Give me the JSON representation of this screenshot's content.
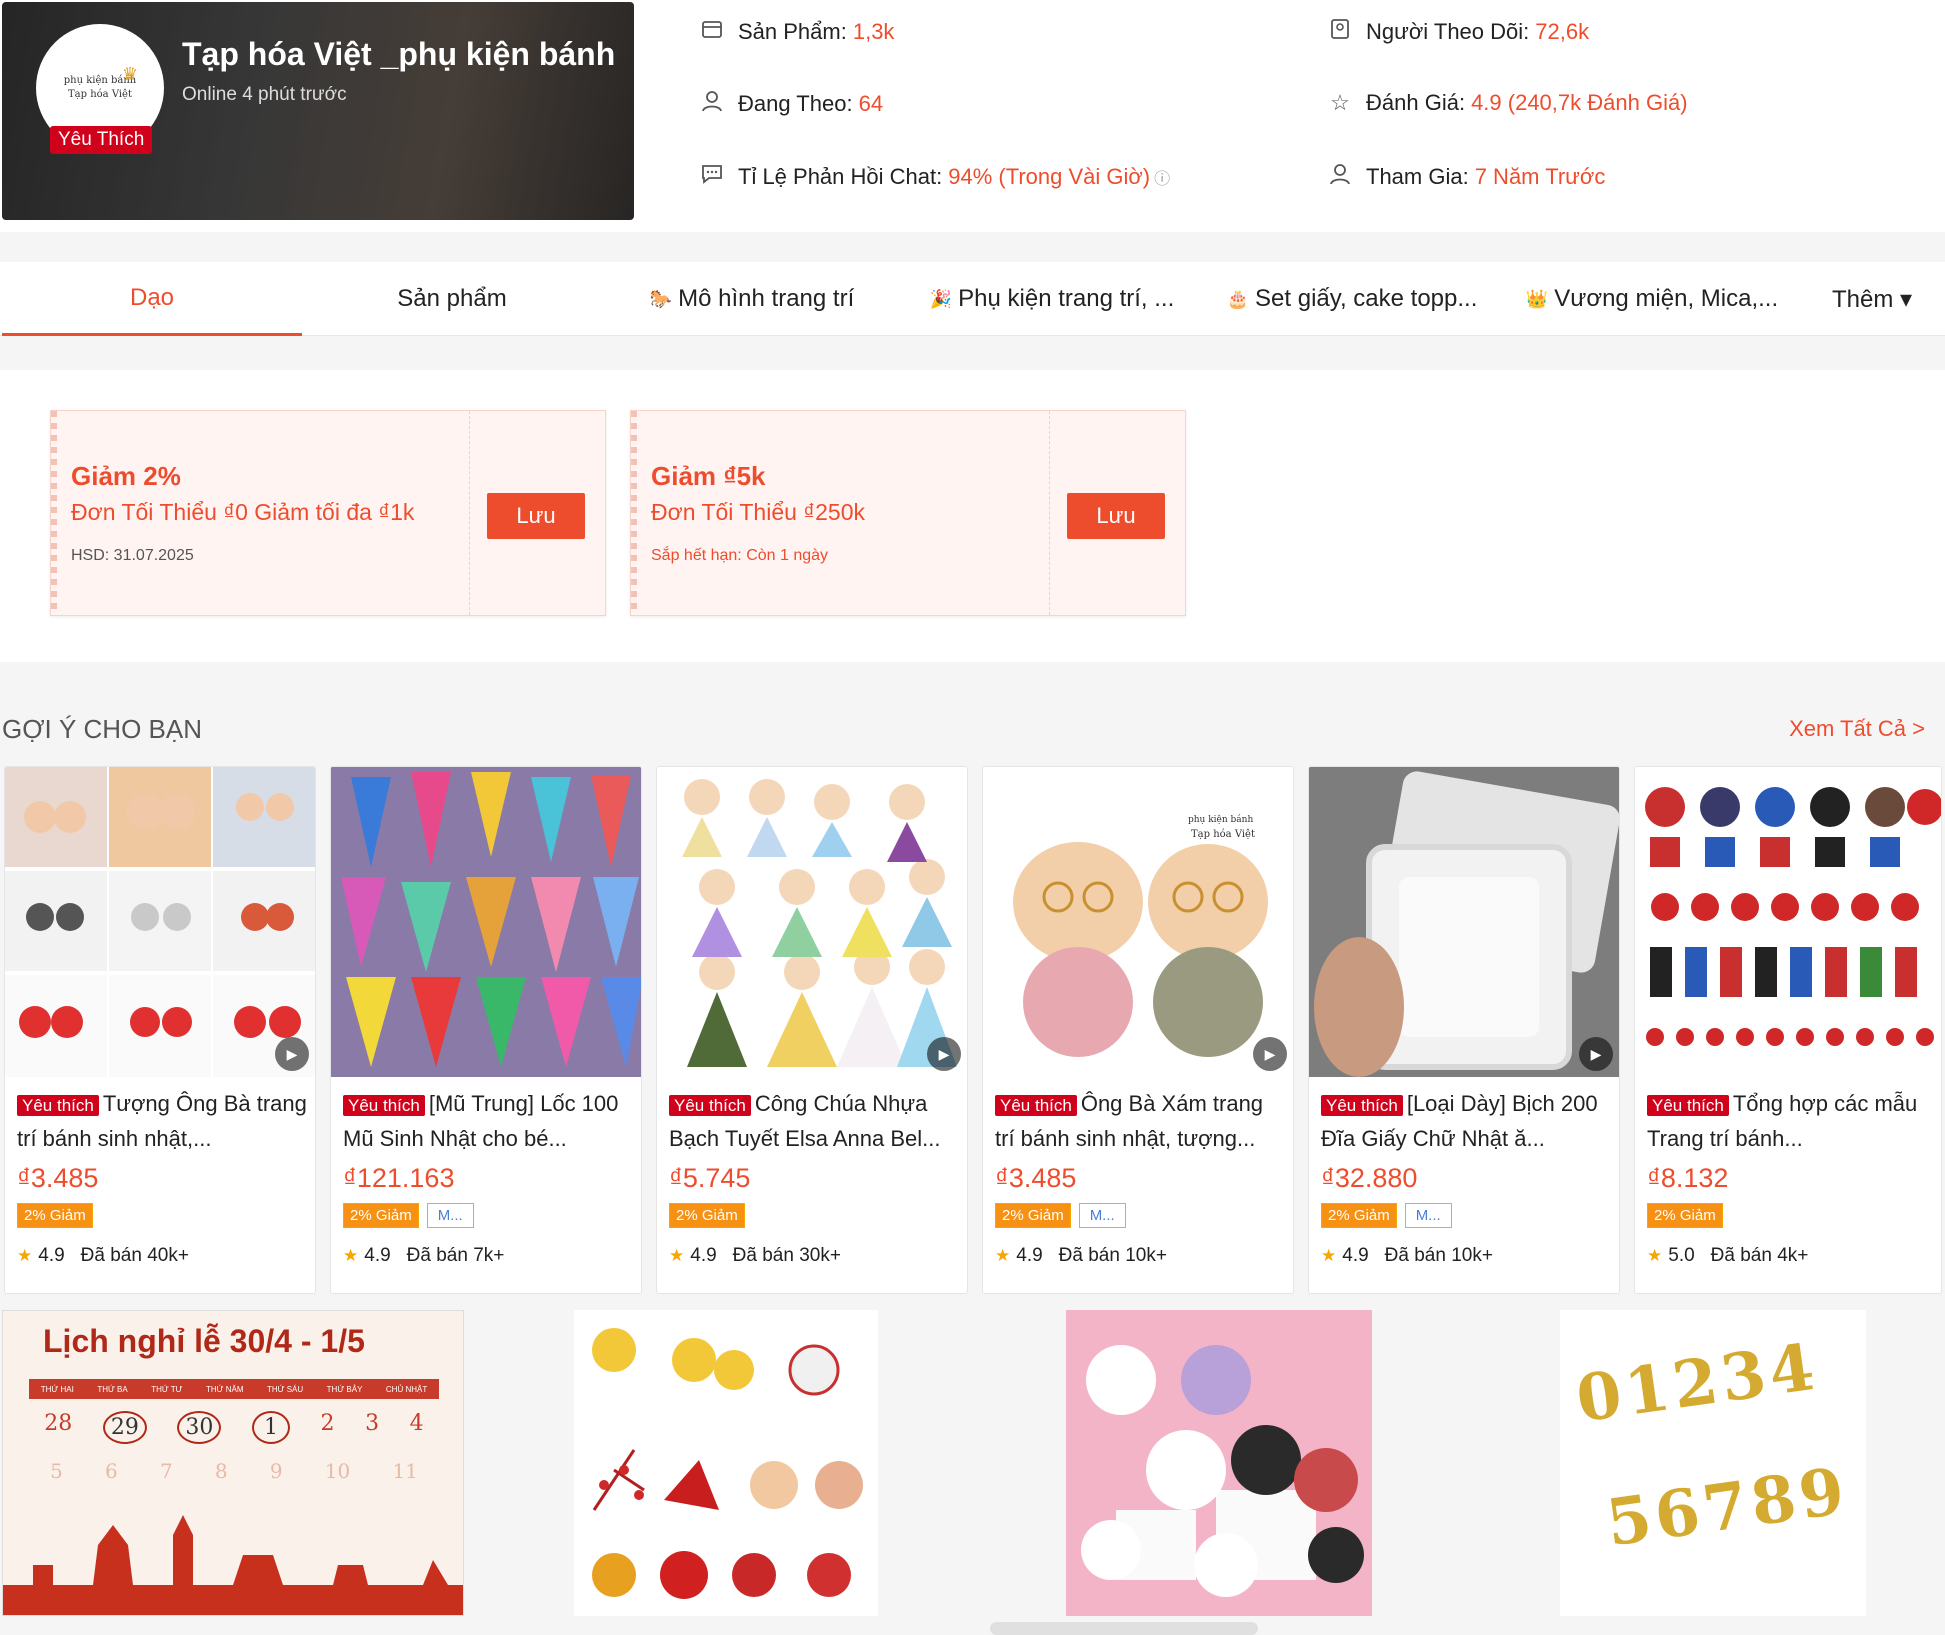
{
  "shop": {
    "name": "Tạp hóa Việt _phụ kiện bánh",
    "online": "Online 4 phút trước",
    "badge": "Yêu Thích",
    "logo_line1": "phụ kiện bánh",
    "logo_line2": "Tạp hóa Việt"
  },
  "stats": {
    "products": {
      "label": "Sản Phẩm:",
      "value": "1,3k",
      "icon": "storefront-icon"
    },
    "following": {
      "label": "Đang Theo:",
      "value": "64",
      "icon": "person-icon"
    },
    "chat": {
      "label": "Tỉ Lệ Phản Hồi Chat:",
      "value": "94% (Trong Vài Giờ)",
      "icon": "chat-icon"
    },
    "followers": {
      "label": "Người Theo Dõi:",
      "value": "72,6k",
      "icon": "followers-icon"
    },
    "rating": {
      "label": "Đánh Giá:",
      "value": "4.9 (240,7k Đánh Giá)",
      "icon": "star-icon"
    },
    "joined": {
      "label": "Tham Gia:",
      "value": "7 Năm Trước",
      "icon": "person-icon"
    }
  },
  "tabs": [
    {
      "label": "Dạo",
      "emoji": ""
    },
    {
      "label": "Sản phẩm",
      "emoji": ""
    },
    {
      "label": "Mô hình trang trí",
      "emoji": "🐎"
    },
    {
      "label": "Phụ kiện trang trí, ...",
      "emoji": "🎉"
    },
    {
      "label": "Set giấy, cake topp...",
      "emoji": "🎂"
    },
    {
      "label": "Vương miện, Mica,...",
      "emoji": "👑"
    },
    {
      "label": "Thêm ▾",
      "emoji": ""
    }
  ],
  "vouchers": [
    {
      "title": "Giảm 2%",
      "desc": "Đơn Tối Thiểu ₫0 Giảm tối đa ₫1k",
      "expiry": "HSD: 31.07.2025",
      "button": "Lưu"
    },
    {
      "title": "Giảm ₫5k",
      "desc": "Đơn Tối Thiểu ₫250k",
      "expiry": "Sắp hết hạn: Còn 1 ngày",
      "button": "Lưu"
    }
  ],
  "recommend": {
    "title": "GỢI Ý CHO BẠN",
    "see_all": "Xem Tất Cả >"
  },
  "products": [
    {
      "fav": "Yêu thích",
      "name": "Tượng Ông Bà trang trí bánh sinh nhật,...",
      "price": "₫3.485",
      "discount": "2% Giảm",
      "extra": "",
      "rating": "4.9",
      "sold": "Đã bán 40k+"
    },
    {
      "fav": "Yêu thích",
      "name": "[Mũ Trung] Lốc 100 Mũ Sinh Nhật cho bé...",
      "price": "₫121.163",
      "discount": "2% Giảm",
      "extra": "M...",
      "rating": "4.9",
      "sold": "Đã bán 7k+"
    },
    {
      "fav": "Yêu thích",
      "name": "Công Chúa Nhựa Bạch Tuyết Elsa Anna Bel...",
      "price": "₫5.745",
      "discount": "2% Giảm",
      "extra": "",
      "rating": "4.9",
      "sold": "Đã bán 30k+"
    },
    {
      "fav": "Yêu thích",
      "name": "Ông Bà Xám trang trí bánh sinh nhật, tượng...",
      "price": "₫3.485",
      "discount": "2% Giảm",
      "extra": "M...",
      "rating": "4.9",
      "sold": "Đã bán 10k+"
    },
    {
      "fav": "Yêu thích",
      "name": "[Loại Dày] Bịch 200 Đĩa Giấy Chữ Nhật ă...",
      "price": "₫32.880",
      "discount": "2% Giảm",
      "extra": "M...",
      "rating": "4.9",
      "sold": "Đã bán 10k+"
    },
    {
      "fav": "Yêu thích",
      "name": "Tổng hợp các mẫu Trang trí bánh...",
      "price": "₫8.132",
      "discount": "2% Giảm",
      "extra": "",
      "rating": "5.0",
      "sold": "Đã bán 4k+"
    }
  ],
  "holiday_banner": {
    "title": "Lịch nghỉ lễ 30/4 - 1/5",
    "days": [
      "THỨ HAI",
      "THỨ BA",
      "THỨ TƯ",
      "THỨ NĂM",
      "THỨ SÁU",
      "THỨ BẢY",
      "CHỦ NHẬT"
    ],
    "row1": [
      "28",
      "29",
      "30",
      "1",
      "2",
      "3",
      "4"
    ],
    "row2": [
      "5",
      "6",
      "7",
      "8",
      "9",
      "10",
      "11"
    ]
  },
  "candles": {
    "row1": "01234",
    "row2": "56789"
  }
}
